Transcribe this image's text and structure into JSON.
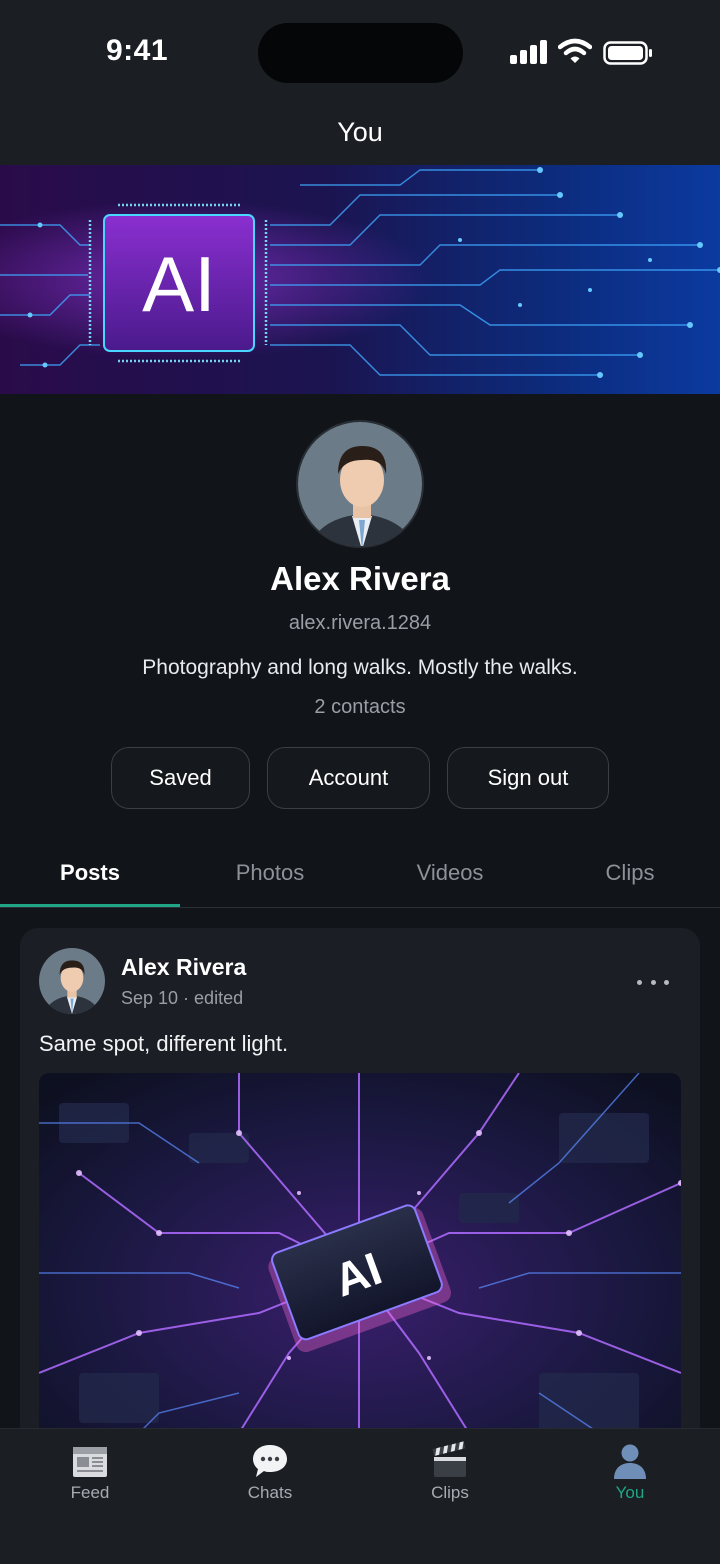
{
  "status_bar": {
    "time": "9:41"
  },
  "header": {
    "title": "You"
  },
  "banner": {
    "chip_text": "AI"
  },
  "profile": {
    "name": "Alex Rivera",
    "handle": "alex.rivera.1284",
    "bio": "Photography and long walks. Mostly the walks.",
    "contacts": "2 contacts"
  },
  "actions": {
    "saved": "Saved",
    "account": "Account",
    "sign_out": "Sign out"
  },
  "tabs": [
    {
      "label": "Posts",
      "active": true
    },
    {
      "label": "Photos",
      "active": false
    },
    {
      "label": "Videos",
      "active": false
    },
    {
      "label": "Clips",
      "active": false
    }
  ],
  "post": {
    "author": "Alex Rivera",
    "meta": "Sep 10 · edited",
    "text": "Same spot, different light.",
    "image_chip_text": "AI"
  },
  "bottom_nav": [
    {
      "label": "Feed",
      "icon": "newspaper-icon",
      "active": false
    },
    {
      "label": "Chats",
      "icon": "speech-bubble-icon",
      "active": false
    },
    {
      "label": "Clips",
      "icon": "clapperboard-icon",
      "active": false
    },
    {
      "label": "You",
      "icon": "person-icon",
      "active": true
    }
  ],
  "colors": {
    "accent": "#1ea687",
    "background": "#111418",
    "surface": "#1b1e23",
    "muted_text": "#9a9ea6"
  }
}
